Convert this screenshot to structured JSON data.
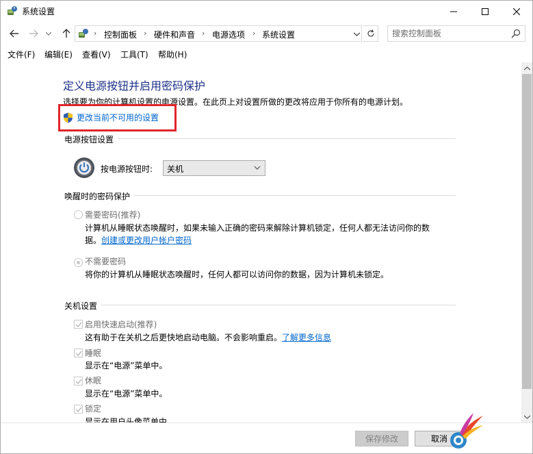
{
  "window": {
    "title": "系统设置",
    "minimize_icon": "minimize-icon",
    "maximize_icon": "maximize-icon",
    "close_icon": "close-icon"
  },
  "address_bar": {
    "breadcrumbs": [
      "控制面板",
      "硬件和声音",
      "电源选项",
      "系统设置"
    ]
  },
  "search": {
    "placeholder": "搜索控制面板"
  },
  "menu": [
    "文件(F)",
    "编辑(E)",
    "查看(V)",
    "工具(T)",
    "帮助(H)"
  ],
  "page": {
    "heading": "定义电源按钮并启用密码保护",
    "intro": "选择要为你的计算机设置的电源设置。在此页上对设置所做的更改将应用于你所有的电源计划。",
    "change_link": "更改当前不可用的设置"
  },
  "power_button": {
    "group_label": "电源按钮设置",
    "label": "按电源按钮时:",
    "selected": "关机"
  },
  "wake_password": {
    "group_label": "唤醒时的密码保护",
    "option_require": {
      "title": "需要密码(推荐)",
      "desc_line1": "计算机从睡眠状态唤醒时，如果未输入正确的密码来解除计算机锁定，任何人都无法访问你的数",
      "desc_line2": "据。",
      "desc_link": "创建或更改用户帐户密码",
      "checked": false
    },
    "option_none": {
      "title": "不需要密码",
      "desc": "将你的计算机从睡眠状态唤醒时，任何人都可以访问你的数据，因为计算机未锁定。",
      "checked": true
    }
  },
  "shutdown": {
    "group_label": "关机设置",
    "items": [
      {
        "title": "启用快速启动(推荐)",
        "desc": "这有助于在关机之后更快地启动电脑。不会影响重启。",
        "link": "了解更多信息",
        "checked": true
      },
      {
        "title": "睡眠",
        "desc": "显示在“电源”菜单中。",
        "checked": true
      },
      {
        "title": "休眠",
        "desc": "显示在“电源”菜单中。",
        "checked": true
      },
      {
        "title": "锁定",
        "desc": "显示在用户头像菜单中。",
        "checked": true
      }
    ]
  },
  "footer": {
    "save": "保存修改",
    "cancel": "取消"
  },
  "colors": {
    "heading": "#1e3287",
    "link": "#0066cc",
    "highlight": "#e0252a"
  }
}
